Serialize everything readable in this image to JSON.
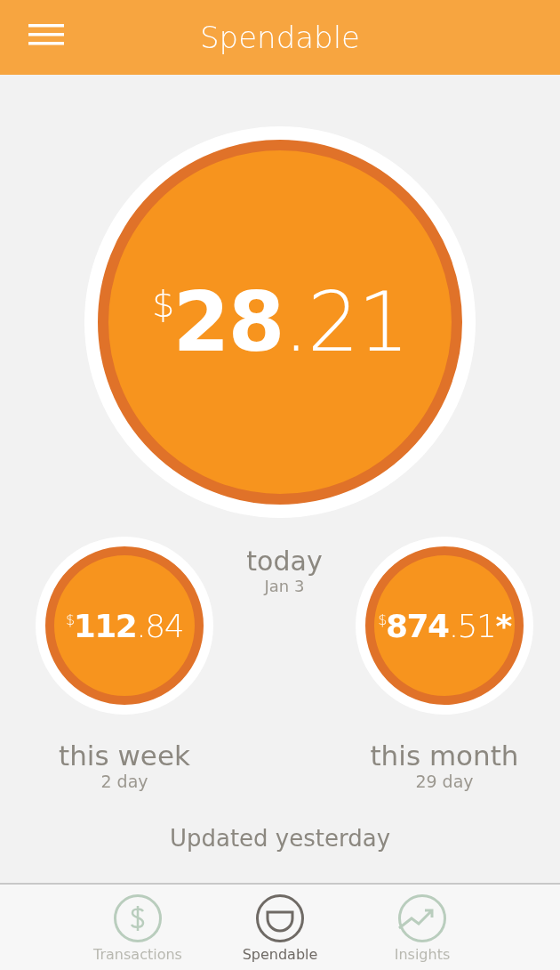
{
  "header": {
    "title": "Spendable"
  },
  "today": {
    "amount": {
      "currency": "$",
      "whole": "28",
      "cents": ".21"
    },
    "label": "today",
    "sublabel": "Jan 3"
  },
  "periods": [
    {
      "amount": {
        "currency": "$",
        "whole": "112",
        "cents": ".84"
      },
      "label": "this week",
      "sublabel": "2 day"
    },
    {
      "amount": {
        "currency": "$",
        "whole": "874",
        "cents": ".51",
        "suffix": "*"
      },
      "label": "this month",
      "sublabel": "29 day"
    }
  ],
  "updated": "Updated yesterday",
  "tabs": [
    {
      "kind": "dollar",
      "label": "Transactions",
      "selected": false
    },
    {
      "kind": "bowl",
      "label": "Spendable",
      "selected": true
    },
    {
      "kind": "trend",
      "label": "Insights",
      "selected": false
    }
  ]
}
